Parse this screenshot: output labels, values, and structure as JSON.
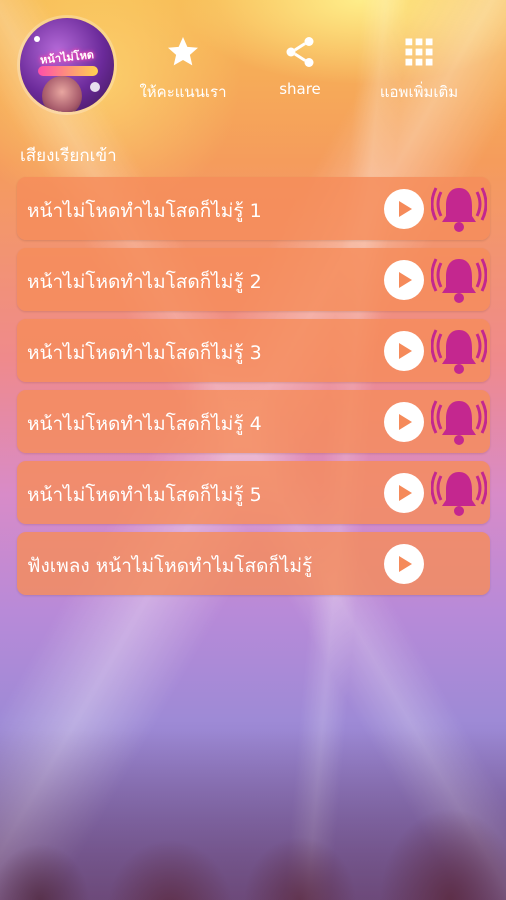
{
  "header": {
    "logo_text": "หน้าไม่โหด",
    "rate_label": "ให้คะแนนเรา",
    "share_label": "share",
    "more_label": "แอพเพิ่มเติม"
  },
  "section_title": "เสียงเรียกเข้า",
  "rows": [
    {
      "label": "หน้าไม่โหดทำไมโสดก็ไม่รู้ 1"
    },
    {
      "label": "หน้าไม่โหดทำไมโสดก็ไม่รู้ 2"
    },
    {
      "label": "หน้าไม่โหดทำไมโสดก็ไม่รู้ 3"
    },
    {
      "label": "หน้าไม่โหดทำไมโสดก็ไม่รู้ 4"
    },
    {
      "label": "หน้าไม่โหดทำไมโสดก็ไม่รู้ 5"
    },
    {
      "label": "ฟังเพลง หน้าไม่โหดทำไมโสดก็ไม่รู้"
    }
  ],
  "icons": {
    "rate": "star-icon",
    "share": "share-icon",
    "more": "apps-grid-icon",
    "play": "play-icon",
    "ringtone": "bell-icon"
  },
  "colors": {
    "row_bg": "#f58c5a",
    "bell": "#c4278f"
  }
}
